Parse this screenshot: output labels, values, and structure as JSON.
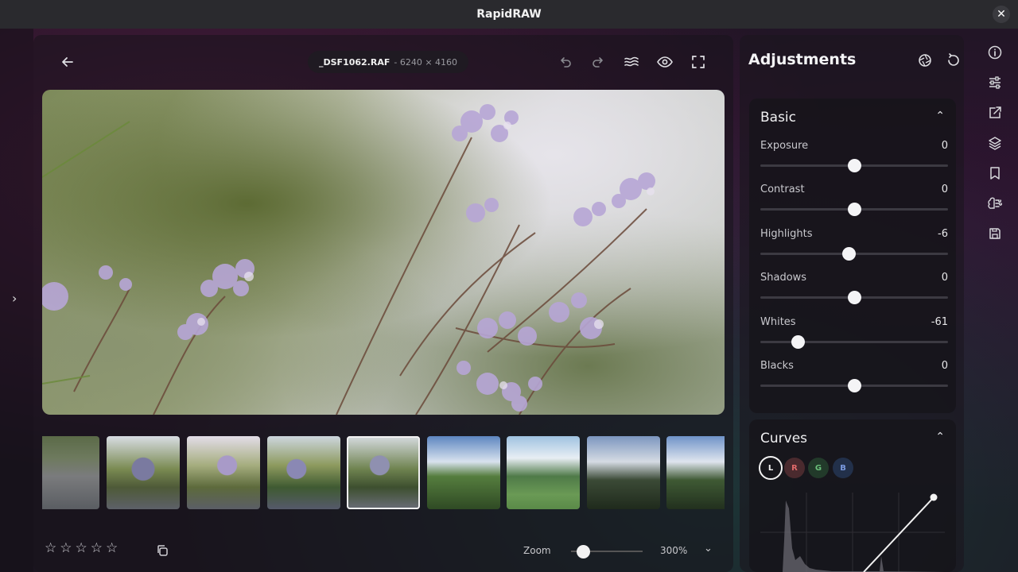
{
  "app": {
    "title": "RapidRAW"
  },
  "file": {
    "name": "_DSF1062.RAF",
    "dims": "- 6240 × 4160"
  },
  "adjustments": {
    "title": "Adjustments"
  },
  "basic": {
    "title": "Basic",
    "sliders": [
      {
        "label": "Exposure",
        "value": "0",
        "level": 0.5
      },
      {
        "label": "Contrast",
        "value": "0",
        "level": 0.5
      },
      {
        "label": "Highlights",
        "value": "-6",
        "level": 0.47
      },
      {
        "label": "Shadows",
        "value": "0",
        "level": 0.5
      },
      {
        "label": "Whites",
        "value": "-61",
        "level": 0.2
      },
      {
        "label": "Blacks",
        "value": "0",
        "level": 0.5
      }
    ]
  },
  "curves": {
    "title": "Curves",
    "channels": [
      "L",
      "R",
      "G",
      "B"
    ],
    "active_channel": "L"
  },
  "rating": {
    "stars": 0,
    "max": 5
  },
  "zoom": {
    "label": "Zoom",
    "value": "300%",
    "level": 0.3
  },
  "filmstrip": {
    "count": 9,
    "selected_index": 4
  },
  "colors": {
    "accent": "#f2f2f2",
    "r": "#b04848",
    "g": "#3f8f50",
    "b": "#3f5f9f"
  }
}
